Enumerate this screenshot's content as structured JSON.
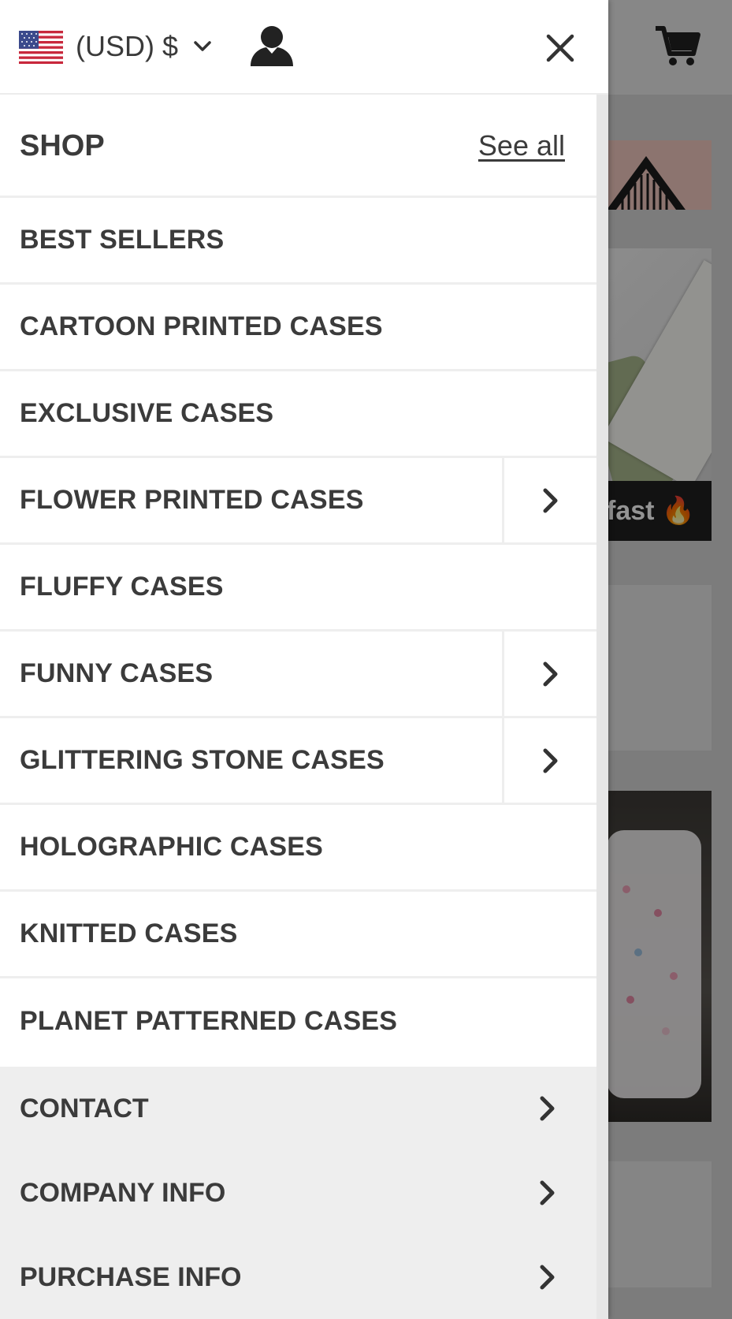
{
  "header": {
    "currency_label": "(USD) $",
    "flag_icon": "us-flag-icon",
    "account_icon": "user-icon",
    "close_icon": "close-icon",
    "cart_icon": "cart-icon"
  },
  "shop": {
    "title": "SHOP",
    "see_all": "See all"
  },
  "categories": [
    {
      "label": "BEST SELLERS",
      "has_submenu": false
    },
    {
      "label": "CARTOON PRINTED CASES",
      "has_submenu": false
    },
    {
      "label": "EXCLUSIVE CASES",
      "has_submenu": false
    },
    {
      "label": "FLOWER PRINTED CASES",
      "has_submenu": true
    },
    {
      "label": "FLUFFY CASES",
      "has_submenu": false
    },
    {
      "label": "FUNNY CASES",
      "has_submenu": true
    },
    {
      "label": "GLITTERING STONE CASES",
      "has_submenu": true
    },
    {
      "label": "HOLOGRAPHIC CASES",
      "has_submenu": false
    },
    {
      "label": "KNITTED CASES",
      "has_submenu": false
    },
    {
      "label": "PLANET PATTERNED CASES",
      "has_submenu": false
    }
  ],
  "info_links": [
    {
      "label": "CONTACT"
    },
    {
      "label": "COMPANY INFO"
    },
    {
      "label": "PURCHASE INFO"
    }
  ],
  "background": {
    "promo_text": "fast",
    "promo_icon": "fire-icon"
  },
  "colors": {
    "text": "#3b3b3b",
    "divider": "#eeeeee",
    "info_bg": "#eeeeee",
    "overlay": "rgba(0,0,0,0.42)"
  }
}
